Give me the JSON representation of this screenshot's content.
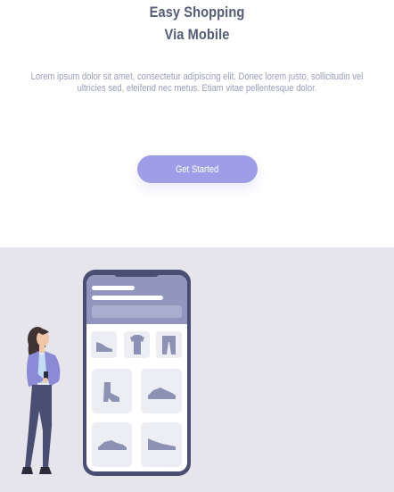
{
  "header": {
    "title_line1": "Easy Shopping",
    "title_line2": "Via Mobile"
  },
  "intro": {
    "text": "Lorem ipsum dolor sit amet, consectetur adipiscing elit. Donec lorem justo, sollicitudin vel ultricies sed, eleifend nec metus. Etiam vitae pellentesque dolor."
  },
  "cta": {
    "label": "Get Started"
  },
  "colors": {
    "accent": "#9e9ee8",
    "phone_frame": "#4a4e72",
    "panel_bg": "#e6e5ec",
    "title": "#555c75",
    "body_text": "#9a9db8"
  },
  "illustration": {
    "product_icons": [
      "shoe-icon",
      "tshirt-icon",
      "pants-icon",
      "boot-icon",
      "sneaker-icon",
      "sneaker-icon",
      "shoe-icon"
    ]
  }
}
